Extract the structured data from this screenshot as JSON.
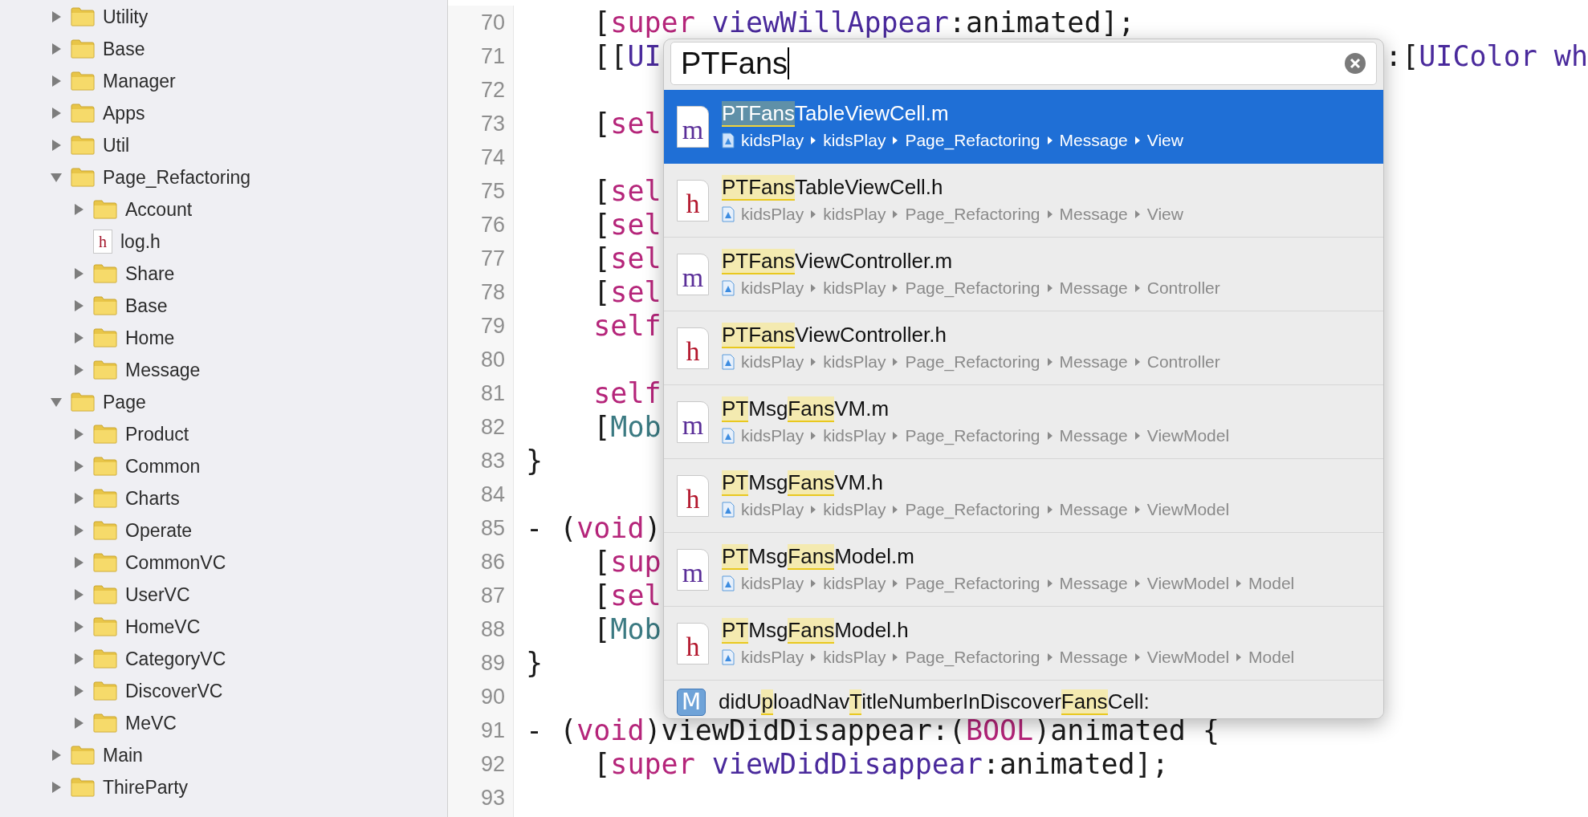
{
  "navigator": {
    "items": [
      {
        "kind": "folder",
        "label": "Utility",
        "expanded": false
      },
      {
        "kind": "folder",
        "label": "Base",
        "expanded": false
      },
      {
        "kind": "folder",
        "label": "Manager",
        "expanded": false
      },
      {
        "kind": "folder",
        "label": "Apps",
        "expanded": false
      },
      {
        "kind": "folder",
        "label": "Util",
        "expanded": false
      },
      {
        "kind": "folder",
        "label": "Page_Refactoring",
        "expanded": true,
        "children": [
          {
            "kind": "folder",
            "label": "Account",
            "expanded": false
          },
          {
            "kind": "file",
            "label": "log.h",
            "icon_letter": "h"
          },
          {
            "kind": "folder",
            "label": "Share",
            "expanded": false
          },
          {
            "kind": "folder",
            "label": "Base",
            "expanded": false
          },
          {
            "kind": "folder",
            "label": "Home",
            "expanded": false
          },
          {
            "kind": "folder",
            "label": "Message",
            "expanded": false
          }
        ]
      },
      {
        "kind": "folder",
        "label": "Page",
        "expanded": true,
        "children": [
          {
            "kind": "folder",
            "label": "Product",
            "expanded": false
          },
          {
            "kind": "folder",
            "label": "Common",
            "expanded": false
          },
          {
            "kind": "folder",
            "label": "Charts",
            "expanded": false
          },
          {
            "kind": "folder",
            "label": "Operate",
            "expanded": false
          },
          {
            "kind": "folder",
            "label": "CommonVC",
            "expanded": false
          },
          {
            "kind": "folder",
            "label": "UserVC",
            "expanded": false
          },
          {
            "kind": "folder",
            "label": "HomeVC",
            "expanded": false
          },
          {
            "kind": "folder",
            "label": "CategoryVC",
            "expanded": false
          },
          {
            "kind": "folder",
            "label": "DiscoverVC",
            "expanded": false
          },
          {
            "kind": "folder",
            "label": "MeVC",
            "expanded": false
          }
        ]
      },
      {
        "kind": "folder",
        "label": "Main",
        "expanded": false
      },
      {
        "kind": "folder",
        "label": "ThireParty",
        "expanded": false
      }
    ]
  },
  "editor": {
    "lines": [
      {
        "number": "70",
        "tokens": [
          {
            "t": "    [",
            "kind": "plain"
          },
          {
            "t": "super ",
            "kind": "keyword"
          },
          {
            "t": "viewWillAppear",
            "kind": "method"
          },
          {
            "t": ":animated];",
            "kind": "plain"
          }
        ]
      },
      {
        "number": "71",
        "tokens": [
          {
            "t": "    [[",
            "kind": "plain"
          },
          {
            "t": "UI",
            "kind": "method"
          }
        ],
        "after": [
          {
            "t": ":[",
            "kind": "plain"
          },
          {
            "t": "UIColor wh",
            "kind": "method"
          }
        ]
      },
      {
        "number": "72"
      },
      {
        "number": "73",
        "tokens": [
          {
            "t": "    [",
            "kind": "plain"
          },
          {
            "t": "sel",
            "kind": "keyword"
          }
        ]
      },
      {
        "number": "74"
      },
      {
        "number": "75",
        "tokens": [
          {
            "t": "    [",
            "kind": "plain"
          },
          {
            "t": "sel",
            "kind": "keyword"
          }
        ]
      },
      {
        "number": "76",
        "tokens": [
          {
            "t": "    [",
            "kind": "plain"
          },
          {
            "t": "sel",
            "kind": "keyword"
          }
        ]
      },
      {
        "number": "77",
        "tokens": [
          {
            "t": "    [",
            "kind": "plain"
          },
          {
            "t": "sel",
            "kind": "keyword"
          }
        ]
      },
      {
        "number": "78",
        "tokens": [
          {
            "t": "    [",
            "kind": "plain"
          },
          {
            "t": "sel",
            "kind": "keyword"
          }
        ]
      },
      {
        "number": "79",
        "tokens": [
          {
            "t": "    self",
            "kind": "keyword"
          }
        ]
      },
      {
        "number": "80"
      },
      {
        "number": "81",
        "tokens": [
          {
            "t": "    self",
            "kind": "keyword"
          }
        ]
      },
      {
        "number": "82",
        "tokens": [
          {
            "t": "    [",
            "kind": "plain"
          },
          {
            "t": "Mob",
            "kind": "class"
          }
        ]
      },
      {
        "number": "83",
        "tokens": [
          {
            "t": "}",
            "kind": "plain"
          }
        ]
      },
      {
        "number": "84"
      },
      {
        "number": "85",
        "tokens": [
          {
            "t": "- (",
            "kind": "plain"
          },
          {
            "t": "void",
            "kind": "keyword"
          },
          {
            "t": ")",
            "kind": "plain"
          }
        ]
      },
      {
        "number": "86",
        "tokens": [
          {
            "t": "    [",
            "kind": "plain"
          },
          {
            "t": "sup",
            "kind": "keyword"
          }
        ]
      },
      {
        "number": "87",
        "tokens": [
          {
            "t": "    [",
            "kind": "plain"
          },
          {
            "t": "sel",
            "kind": "keyword"
          }
        ]
      },
      {
        "number": "88",
        "tokens": [
          {
            "t": "    [",
            "kind": "plain"
          },
          {
            "t": "Mob",
            "kind": "class"
          }
        ]
      },
      {
        "number": "89",
        "tokens": [
          {
            "t": "}",
            "kind": "plain"
          }
        ]
      },
      {
        "number": "90"
      },
      {
        "number": "91",
        "tokens": [
          {
            "t": "- (",
            "kind": "plain"
          },
          {
            "t": "void",
            "kind": "keyword"
          },
          {
            "t": ")viewDidDisappear:(",
            "kind": "plain"
          },
          {
            "t": "BOOL",
            "kind": "keyword"
          },
          {
            "t": ")animated {",
            "kind": "plain"
          }
        ]
      },
      {
        "number": "92",
        "tokens": [
          {
            "t": "    [",
            "kind": "plain"
          },
          {
            "t": "super ",
            "kind": "keyword"
          },
          {
            "t": "viewDidDisappear",
            "kind": "method"
          },
          {
            "t": ":animated];",
            "kind": "plain"
          }
        ]
      },
      {
        "number": "93"
      }
    ]
  },
  "quick_open": {
    "query": "PTFans",
    "results": [
      {
        "kind": "file",
        "icon_letter": "m",
        "selected": true,
        "title": [
          {
            "t": "PTFans",
            "match": true
          },
          {
            "t": "TableViewCell.m",
            "match": false
          }
        ],
        "path": [
          "kidsPlay",
          "kidsPlay",
          "Page_Refactoring",
          "Message",
          "View"
        ]
      },
      {
        "kind": "file",
        "icon_letter": "h",
        "selected": false,
        "title": [
          {
            "t": "PTFans",
            "match": true
          },
          {
            "t": "TableViewCell.h",
            "match": false
          }
        ],
        "path": [
          "kidsPlay",
          "kidsPlay",
          "Page_Refactoring",
          "Message",
          "View"
        ]
      },
      {
        "kind": "file",
        "icon_letter": "m",
        "selected": false,
        "title": [
          {
            "t": "PTFans",
            "match": true
          },
          {
            "t": "ViewController.m",
            "match": false
          }
        ],
        "path": [
          "kidsPlay",
          "kidsPlay",
          "Page_Refactoring",
          "Message",
          "Controller"
        ]
      },
      {
        "kind": "file",
        "icon_letter": "h",
        "selected": false,
        "title": [
          {
            "t": "PTFans",
            "match": true
          },
          {
            "t": "ViewController.h",
            "match": false
          }
        ],
        "path": [
          "kidsPlay",
          "kidsPlay",
          "Page_Refactoring",
          "Message",
          "Controller"
        ]
      },
      {
        "kind": "file",
        "icon_letter": "m",
        "selected": false,
        "title": [
          {
            "t": "PT",
            "match": true
          },
          {
            "t": "Msg",
            "match": false
          },
          {
            "t": "Fans",
            "match": true
          },
          {
            "t": "VM.m",
            "match": false
          }
        ],
        "path": [
          "kidsPlay",
          "kidsPlay",
          "Page_Refactoring",
          "Message",
          "ViewModel"
        ]
      },
      {
        "kind": "file",
        "icon_letter": "h",
        "selected": false,
        "title": [
          {
            "t": "PT",
            "match": true
          },
          {
            "t": "Msg",
            "match": false
          },
          {
            "t": "Fans",
            "match": true
          },
          {
            "t": "VM.h",
            "match": false
          }
        ],
        "path": [
          "kidsPlay",
          "kidsPlay",
          "Page_Refactoring",
          "Message",
          "ViewModel"
        ]
      },
      {
        "kind": "file",
        "icon_letter": "m",
        "selected": false,
        "title": [
          {
            "t": "PT",
            "match": true
          },
          {
            "t": "Msg",
            "match": false
          },
          {
            "t": "Fans",
            "match": true
          },
          {
            "t": "Model.m",
            "match": false
          }
        ],
        "path": [
          "kidsPlay",
          "kidsPlay",
          "Page_Refactoring",
          "Message",
          "ViewModel",
          "Model"
        ]
      },
      {
        "kind": "file",
        "icon_letter": "h",
        "selected": false,
        "title": [
          {
            "t": "PT",
            "match": true
          },
          {
            "t": "Msg",
            "match": false
          },
          {
            "t": "Fans",
            "match": true
          },
          {
            "t": "Model.h",
            "match": false
          }
        ],
        "path": [
          "kidsPlay",
          "kidsPlay",
          "Page_Refactoring",
          "Message",
          "ViewModel",
          "Model"
        ]
      },
      {
        "kind": "method",
        "icon_letter": "M",
        "selected": false,
        "title": [
          {
            "t": "didU",
            "match": false
          },
          {
            "t": "p",
            "match": true
          },
          {
            "t": "loadNav",
            "match": false
          },
          {
            "t": "T",
            "match": true
          },
          {
            "t": "itleNumberInDiscover",
            "match": false
          },
          {
            "t": "Fans",
            "match": true
          },
          {
            "t": "Cell:",
            "match": false
          }
        ]
      }
    ]
  }
}
